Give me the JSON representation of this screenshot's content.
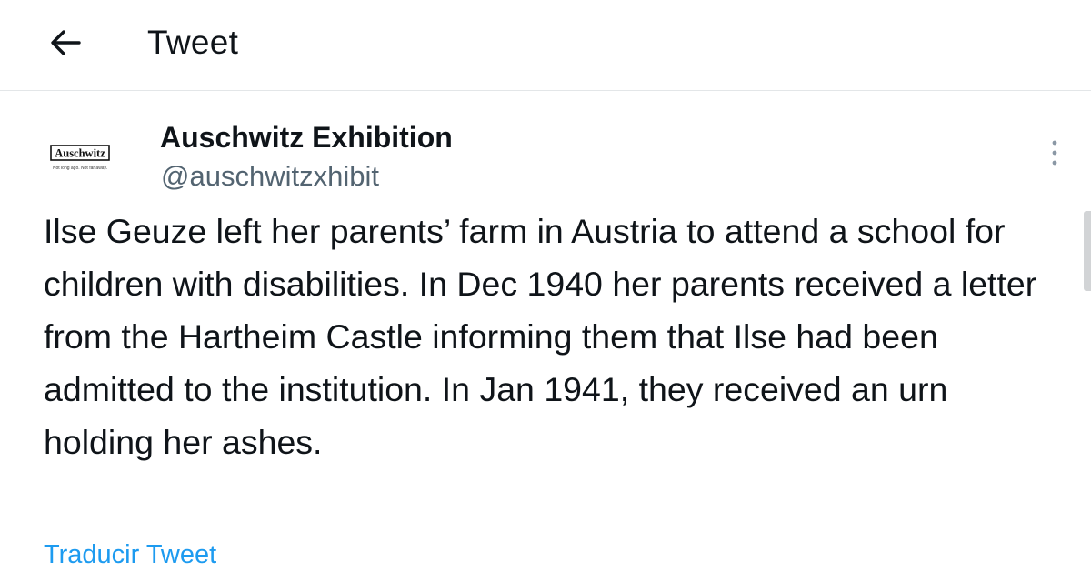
{
  "header": {
    "back_icon": "arrow-left-icon",
    "title": "Tweet"
  },
  "tweet": {
    "avatar": {
      "logo_text": "Auschwitz",
      "logo_tagline": "Not long ago. Not far away."
    },
    "display_name": "Auschwitz Exhibition",
    "handle": "@auschwitzxhibit",
    "more_icon": "more-vertical-icon",
    "text": "Ilse Geuze left her parents’ farm in Austria to attend a school for children with disabilities. In Dec 1940 her parents received a letter from the Hartheim Castle informing them that Ilse had been admitted to the institution. In Jan 1941, they received an urn holding her ashes.",
    "translate_label": "Traducir Tweet"
  },
  "colors": {
    "text": "#0f1419",
    "secondary": "#536471",
    "link": "#1d9bf0",
    "divider": "#e3e6e8"
  }
}
